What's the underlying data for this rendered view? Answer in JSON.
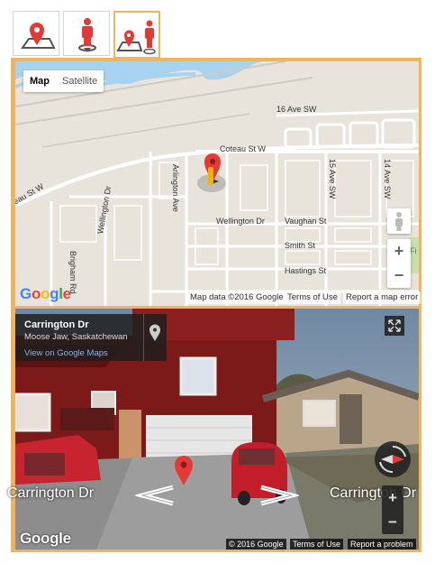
{
  "tabs": [
    {
      "name": "map-view",
      "active": false
    },
    {
      "name": "street-view",
      "active": false
    },
    {
      "name": "map-and-street-view",
      "active": true
    }
  ],
  "map": {
    "type_buttons": {
      "map": "Map",
      "satellite": "Satellite"
    },
    "streets": [
      "16 Ave SW",
      "Coteau St W",
      "Arlington Ave",
      "15 Ave SW",
      "14 Ave SW",
      "eau St W",
      "Wellington Dr",
      "Vaughan St",
      "Smith St",
      "Hastings St",
      "Brigham Rd",
      "Wellington Dr"
    ],
    "zoom_in": "+",
    "zoom_out": "−",
    "attribution": {
      "data": "Map data ©2016 Google",
      "terms": "Terms of Use",
      "report": "Report a map error"
    },
    "logo": "Google",
    "edge_label": "Fi"
  },
  "streetview": {
    "address_title": "Carrington Dr",
    "address_sub": "Moose Jaw, Saskatchewan",
    "view_link": "View on Google Maps",
    "label_left": "Carrington Dr",
    "label_right": "Carrington Dr",
    "zoom_in": "+",
    "zoom_out": "−",
    "attribution": {
      "copy": "© 2016 Google",
      "terms": "Terms of Use",
      "report": "Report a problem"
    },
    "logo": "Google"
  },
  "colors": {
    "accent": "#f0b45c",
    "marker": "#e53935",
    "map_bg": "#e8e4dc"
  }
}
